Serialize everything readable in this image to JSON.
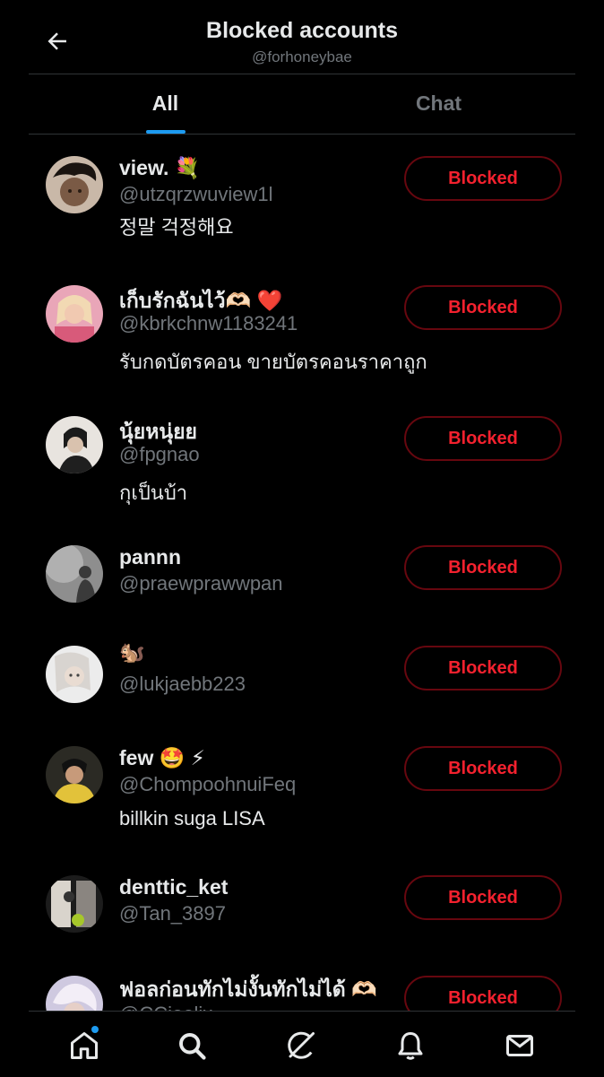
{
  "header": {
    "title": "Blocked accounts",
    "subtitle": "@forhoneybae",
    "back_icon": "arrow-left-icon"
  },
  "tabs": [
    {
      "label": "All",
      "active": true
    },
    {
      "label": "Chat",
      "active": false
    }
  ],
  "accounts": [
    {
      "name": "view. 💐",
      "handle": "@utzqrzwuview1l",
      "bio": "정말 걱정해요",
      "button": "Blocked"
    },
    {
      "name": "เก็บรักฉันไว้🫶🏻 ❤️",
      "handle": "@kbrkchnw1183241",
      "bio": "รับกดบัตรคอน ขายบัตรคอนราคาถูก",
      "button": "Blocked"
    },
    {
      "name": "นุ้ยหนุ่ยย",
      "handle": "@fpgnao",
      "bio": "กุเป็นบ้า",
      "button": "Blocked"
    },
    {
      "name": "pannn",
      "handle": "@praewprawwpan",
      "bio": "",
      "button": "Blocked"
    },
    {
      "name": "🐿️",
      "handle": "@lukjaebb223",
      "bio": "",
      "button": "Blocked"
    },
    {
      "name": "few 🤩 ⚡",
      "handle": "@ChompoohnuiFeq",
      "bio": "billkin suga LISA",
      "button": "Blocked"
    },
    {
      "name": "denttic_ket",
      "handle": "@Tan_3897",
      "bio": "",
      "button": "Blocked"
    },
    {
      "name": "ฟอลก่อนทักไม่งั้นทักไม่ได้ 🫶🏻",
      "handle": "@CCjeelix",
      "bio": "",
      "button": "Blocked"
    }
  ],
  "bottom_nav": [
    {
      "icon": "home-icon",
      "has_notification_dot": true
    },
    {
      "icon": "search-icon"
    },
    {
      "icon": "grok-icon"
    },
    {
      "icon": "bell-icon"
    },
    {
      "icon": "mail-icon"
    }
  ],
  "colors": {
    "background": "#000000",
    "text_primary": "#e7e9ea",
    "text_secondary": "#71767b",
    "accent": "#1d9bf0",
    "blocked_text": "#f4212e",
    "blocked_border": "#67070f",
    "divider": "#2f3336"
  }
}
